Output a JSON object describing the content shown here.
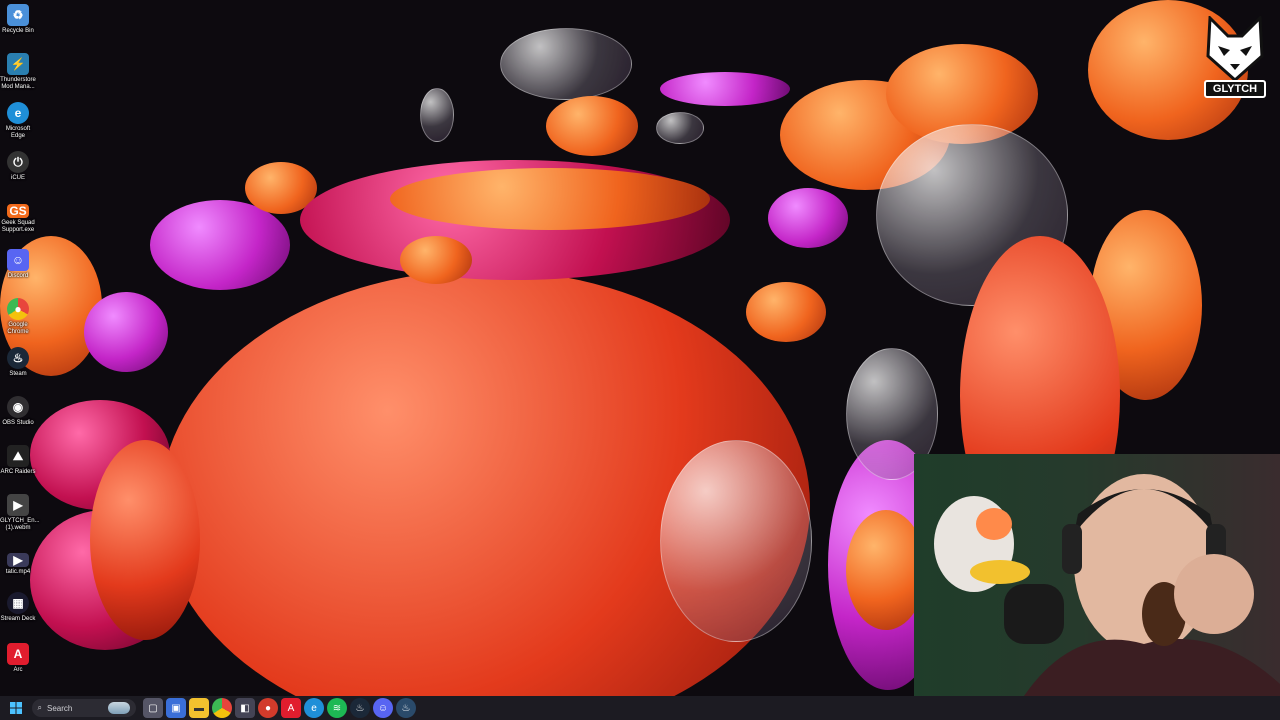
{
  "desktop": {
    "icons": [
      {
        "label": "Recycle Bin",
        "icon": "recycle-bin-icon",
        "color": "#4a90d9"
      },
      {
        "label": "Thunderstore Mod Mana...",
        "icon": "thunderstore-icon",
        "color": "#2a7fb0"
      },
      {
        "label": "Microsoft Edge",
        "icon": "edge-icon",
        "color": "#1f8fd8"
      },
      {
        "label": "iCUE",
        "icon": "icue-icon",
        "color": "#333333"
      },
      {
        "label": "Geek Squad Support.exe",
        "icon": "geek-squad-icon",
        "color": "#f26a1b"
      },
      {
        "label": "Discord",
        "icon": "discord-icon",
        "color": "#5865f2"
      },
      {
        "label": "Google Chrome",
        "icon": "chrome-icon",
        "color": "#e8453c"
      },
      {
        "label": "Steam",
        "icon": "steam-icon",
        "color": "#1b2838"
      },
      {
        "label": "OBS Studio",
        "icon": "obs-icon",
        "color": "#302e31"
      },
      {
        "label": "ARC Raiders",
        "icon": "arc-raiders-icon",
        "color": "#222222"
      },
      {
        "label": "GLYTCH_En... (1).webm",
        "icon": "video-file-icon",
        "color": "#444444"
      },
      {
        "label": "tatic.mp4",
        "icon": "video-file-icon",
        "color": "#3a3a5a"
      },
      {
        "label": "Stream Deck",
        "icon": "stream-deck-icon",
        "color": "#1a1a2e"
      },
      {
        "label": "Arc",
        "icon": "arc-icon",
        "color": "#e11d2e"
      }
    ]
  },
  "logo": {
    "text": "GLYTCH"
  },
  "taskbar": {
    "search_placeholder": "Search",
    "apps": [
      {
        "name": "task-view-icon",
        "color": "#555566"
      },
      {
        "name": "store-icon",
        "color": "#3a6fd8"
      },
      {
        "name": "file-explorer-icon",
        "color": "#f2c12e"
      },
      {
        "name": "chrome-taskbar-icon",
        "color": "#e8453c"
      },
      {
        "name": "app-icon",
        "color": "#444455"
      },
      {
        "name": "chrome-alt-icon",
        "color": "#d23b2b"
      },
      {
        "name": "arc-taskbar-icon",
        "color": "#e11d2e"
      },
      {
        "name": "edge-taskbar-icon",
        "color": "#1f8fd8"
      },
      {
        "name": "spotify-icon",
        "color": "#1db954"
      },
      {
        "name": "steam-taskbar-icon",
        "color": "#1b2838"
      },
      {
        "name": "discord-taskbar-icon",
        "color": "#5865f2"
      },
      {
        "name": "steam-alt-icon",
        "color": "#2a4a6a"
      }
    ]
  }
}
